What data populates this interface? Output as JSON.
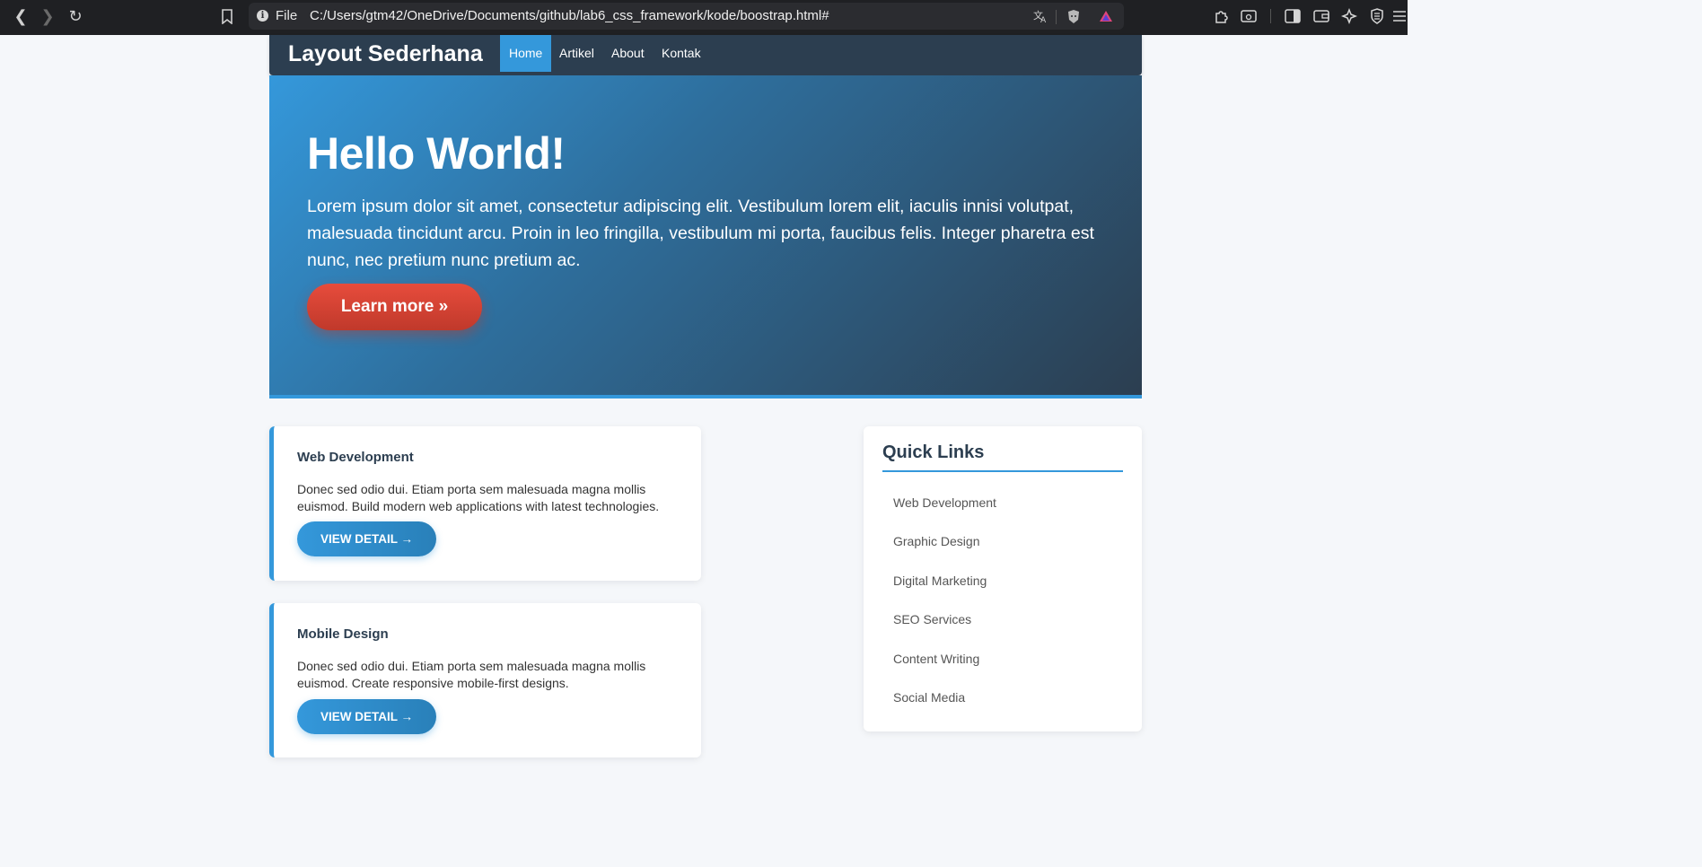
{
  "browser": {
    "scheme": "File",
    "url": "C:/Users/gtm42/OneDrive/Documents/github/lab6_css_framework/kode/boostrap.html#",
    "icons": [
      "back-arrow-icon",
      "forward-arrow-icon",
      "reload-icon",
      "bookmark-icon",
      "info-icon",
      "translate-icon",
      "brave-shield-icon",
      "rewards-icon",
      "extensions-icon",
      "search-tabs-icon",
      "sidebar-icon",
      "wallet-icon",
      "leo-ai-icon",
      "vpn-icon",
      "menu-icon"
    ]
  },
  "nav": {
    "brand": "Layout Sederhana",
    "links": [
      "Home",
      "Artikel",
      "About",
      "Kontak"
    ],
    "active_color": "#3498db"
  },
  "hero": {
    "title": "Hello World!",
    "text": "Lorem ipsum dolor sit amet, consectetur adipiscing elit. Vestibulum lorem elit, iaculis innisi volutpat, malesuada tincidunt arcu. Proin in leo fringilla, vestibulum mi porta, faucibus felis. Integer pharetra est nunc, nec pretium nunc pretium ac.",
    "button": "Learn more  »"
  },
  "cards": [
    {
      "title": "Web Development",
      "text": "Donec sed odio dui. Etiam porta sem malesuada magna mollis euismod. Build modern web applications with latest technologies.",
      "button": "VIEW DETAIL  →"
    },
    {
      "title": "Mobile Design",
      "text": "Donec sed odio dui. Etiam porta sem malesuada magna mollis euismod. Create responsive mobile-first designs.",
      "button": "VIEW DETAIL  →"
    }
  ],
  "sidebar": {
    "title": "Quick Links",
    "links": [
      "Web Development",
      "Graphic Design",
      "Digital Marketing",
      "SEO Services",
      "Content Writing",
      "Social Media"
    ]
  },
  "colors": {
    "primary": "#3498db",
    "dark": "#2c3e50",
    "accent": "#e74c3c"
  }
}
